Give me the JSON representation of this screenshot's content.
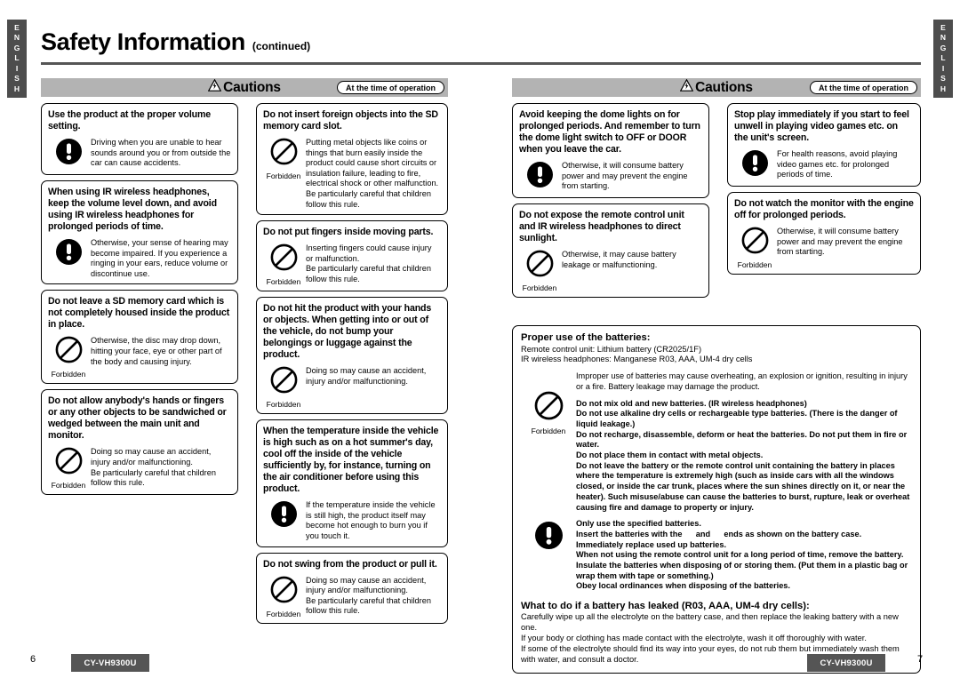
{
  "document": {
    "title": "Safety Information",
    "title_suffix": "(continued)",
    "language_tab": "ENGLISH",
    "language_tab_letters": [
      "E",
      "N",
      "G",
      "L",
      "I",
      "S",
      "H"
    ]
  },
  "caution_header": {
    "label": "Cautions",
    "icon": "warning-triangle-lightning-icon",
    "badge": "At the time of operation"
  },
  "icons": {
    "mandatory": "exclamation-filled-circle-icon",
    "forbidden": "prohibition-slash-circle-icon",
    "forbidden_caption": "Forbidden"
  },
  "left_page": {
    "column_1": [
      {
        "heading": "Use the product at the proper volume setting.",
        "icon": "mandatory",
        "caption": "",
        "body": "Driving when you are unable to hear sounds around you or from outside the car can cause accidents."
      },
      {
        "heading": "When using IR wireless headphones, keep the volume level down, and avoid using IR wireless headphones for prolonged periods of time.",
        "icon": "mandatory",
        "caption": "",
        "body": "Otherwise, your sense of hearing may become impaired. If you experience a ringing in your ears, reduce volume or discontinue use."
      },
      {
        "heading": "Do not leave a SD memory card which is not completely housed inside the product in place.",
        "icon": "forbidden",
        "caption": "Forbidden",
        "body": "Otherwise, the disc may drop down, hitting your face, eye or other part of the body and causing injury."
      },
      {
        "heading": "Do not allow anybody's hands or fingers or any other objects to be sandwiched or wedged between the main unit and monitor.",
        "icon": "forbidden",
        "caption": "Forbidden",
        "body": "Doing so may cause an accident, injury and/or malfunctioning.\nBe particularly careful that children follow this rule."
      }
    ],
    "column_2": [
      {
        "heading": "Do not insert foreign objects into the SD memory card slot.",
        "icon": "forbidden",
        "caption": "Forbidden",
        "body": "Putting metal objects like coins or things that burn easily inside the product could cause short circuits or insulation failure, leading to fire, electrical shock or other malfunction.\nBe particularly careful that children follow this rule."
      },
      {
        "heading": "Do not put fingers inside moving parts.",
        "icon": "forbidden",
        "caption": "Forbidden",
        "body": "Inserting fingers could cause injury or malfunction.\nBe particularly careful that children follow this rule."
      },
      {
        "heading": "Do not hit the product with your hands or objects. When getting into or out of the vehicle, do not bump your belongings or luggage against the product.",
        "icon": "forbidden",
        "caption": "Forbidden",
        "body": "Doing so may cause an accident, injury and/or malfunctioning."
      },
      {
        "heading": "When the temperature inside the vehicle is high such as on a hot summer's day, cool off the inside of the vehicle sufficiently by, for instance, turning on the air conditioner before using this product.",
        "icon": "mandatory",
        "caption": "",
        "body": "If the temperature inside the vehicle is still high, the product itself may become hot enough to burn you if you touch it."
      },
      {
        "heading": "Do not swing from the product or pull it.",
        "icon": "forbidden",
        "caption": "Forbidden",
        "body": "Doing so may cause an accident, injury and/or malfunctioning.\nBe particularly careful that children follow this rule."
      }
    ],
    "page_number": "6",
    "model_chip": "CY-VH9300U"
  },
  "right_page": {
    "column_1": [
      {
        "heading": "Avoid keeping the dome lights on for prolonged periods. And remember to turn the dome light switch to OFF or DOOR when you leave the car.",
        "icon": "mandatory",
        "caption": "",
        "body": "Otherwise, it will consume battery power and may prevent the engine from starting."
      },
      {
        "heading": "Do not expose the remote control unit and IR wireless headphones to direct sunlight.",
        "icon": "forbidden",
        "caption": "Forbidden",
        "body": "Otherwise, it may cause battery leakage or malfunctioning."
      }
    ],
    "column_2": [
      {
        "heading": "Stop play immediately if you start to feel unwell in playing video games etc. on the unit's screen.",
        "icon": "mandatory",
        "caption": "",
        "body": "For health reasons, avoid playing video games etc. for prolonged periods of time."
      },
      {
        "heading": "Do not watch the monitor with the engine off for prolonged periods.",
        "icon": "forbidden",
        "caption": "Forbidden",
        "body": "Otherwise, it will consume battery power and may prevent the engine from starting."
      }
    ],
    "battery_section": {
      "title": "Proper use of the batteries:",
      "spec_lines": [
        "Remote control unit: Lithium battery (CR2025/1F)",
        "IR wireless headphones: Manganese R03, AAA, UM-4 dry cells"
      ],
      "lead_paragraph": "Improper use of batteries may cause overheating, an explosion or ignition, resulting in injury or a fire. Battery leakage may damage the product.",
      "forbidden_icon": "forbidden",
      "forbidden_caption": "Forbidden",
      "forbidden_lines": [
        "Do not mix old and new batteries. (IR wireless headphones)",
        "Do not use alkaline dry cells or rechargeable type batteries. (There is the danger of liquid leakage.)",
        "Do not recharge, disassemble, deform or heat the batteries. Do not put them in fire or water.",
        "Do not place them in contact with metal objects.",
        "Do not leave the battery or the remote control unit containing the battery in places where the temperature is extremely high (such as inside cars with all the windows closed, or inside the car trunk, places where the sun shines directly on it, or near the heater). Such misuse/abuse can cause the batteries to burst, rupture, leak or overheat causing fire and damage to property or injury."
      ],
      "mandatory_icon": "mandatory",
      "mandatory_lines": [
        "Only use the specified batteries.",
        "Insert the batteries with the      and      ends as shown on the battery case.",
        "Immediately replace used up batteries.",
        "When not using the remote control unit for a long period of time, remove the battery.",
        "Insulate the batteries when disposing of or storing them. (Put them in a plastic bag or wrap them with tape or something.)",
        "Obey local ordinances when disposing of the batteries."
      ],
      "leak_title": "What to do if a battery has leaked (R03, AAA, UM-4 dry cells):",
      "leak_lines": [
        "Carefully wipe up all the electrolyte on the battery case, and then replace the leaking battery with a new one.",
        "If your body or clothing has made contact with the electrolyte, wash it off thoroughly with water.",
        "If some of the electrolyte should find its way into your eyes, do not rub them but immediately wash them with water, and consult a doctor."
      ]
    },
    "page_number": "7",
    "model_chip": "CY-VH9300U"
  },
  "colors": {
    "tab_bg": "#4d4d4d",
    "caution_bar_bg": "#b3b3b3",
    "rule": "#555555",
    "footer_chip": "#555555",
    "text": "#000000"
  }
}
